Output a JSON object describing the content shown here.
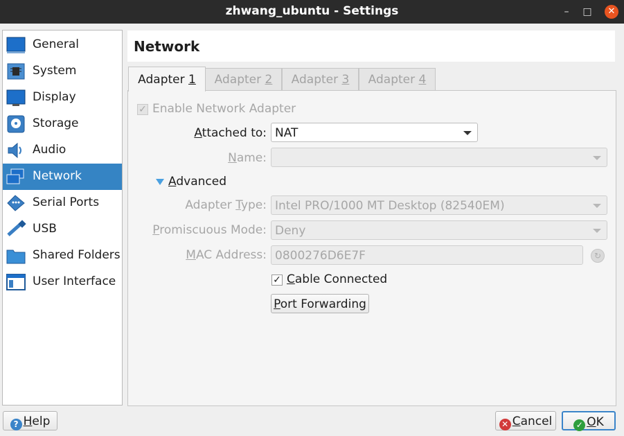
{
  "window": {
    "title": "zhwang_ubuntu - Settings"
  },
  "sidebar": {
    "items": [
      {
        "label": "General",
        "icon": "general-icon",
        "active": false
      },
      {
        "label": "System",
        "icon": "system-chip-icon",
        "active": false
      },
      {
        "label": "Display",
        "icon": "display-monitor-icon",
        "active": false
      },
      {
        "label": "Storage",
        "icon": "storage-disk-icon",
        "active": false
      },
      {
        "label": "Audio",
        "icon": "audio-speaker-icon",
        "active": false
      },
      {
        "label": "Network",
        "icon": "network-icon",
        "active": true
      },
      {
        "label": "Serial Ports",
        "icon": "serial-port-icon",
        "active": false
      },
      {
        "label": "USB",
        "icon": "usb-icon",
        "active": false
      },
      {
        "label": "Shared Folders",
        "icon": "folder-icon",
        "active": false
      },
      {
        "label": "User Interface",
        "icon": "user-interface-icon",
        "active": false
      }
    ]
  },
  "header": {
    "title": "Network"
  },
  "tabs": [
    {
      "label_prefix": "Adapter ",
      "mnemonic": "1",
      "active": true
    },
    {
      "label_prefix": "Adapter ",
      "mnemonic": "2",
      "active": false
    },
    {
      "label_prefix": "Adapter ",
      "mnemonic": "3",
      "active": false
    },
    {
      "label_prefix": "Adapter ",
      "mnemonic": "4",
      "active": false
    }
  ],
  "form": {
    "enable_adapter": {
      "label": "Enable Network Adapter",
      "checked": true,
      "enabled": false
    },
    "attached_to": {
      "label_mn": "A",
      "label_rest": "ttached to:",
      "value": "NAT"
    },
    "name": {
      "label_mn": "N",
      "label_rest": "ame:",
      "value": ""
    },
    "advanced": {
      "label_mn": "A",
      "label_rest": "dvanced",
      "expanded": true
    },
    "adapter_type": {
      "label_a": "Adapter ",
      "label_mn": "T",
      "label_b": "ype:",
      "value": "Intel PRO/1000 MT Desktop (82540EM)"
    },
    "promiscuous": {
      "label_mn": "P",
      "label_rest": "romiscuous Mode:",
      "value": "Deny"
    },
    "mac": {
      "label_mn": "M",
      "label_rest": "AC Address:",
      "value": "0800276D6E7F"
    },
    "cable_connected": {
      "label_mn": "C",
      "label_rest": "able Connected",
      "checked": true
    },
    "port_forwarding": {
      "label_mn": "P",
      "label_rest": "ort Forwarding"
    }
  },
  "footer": {
    "help": {
      "label_mn": "H",
      "label_rest": "elp"
    },
    "cancel": {
      "label_mn": "C",
      "label_rest": "ancel"
    },
    "ok": {
      "label_mn": "O",
      "label_rest": "K"
    }
  },
  "colors": {
    "accent": "#3584c4",
    "titlebar": "#2b2b2b",
    "close": "#e95420"
  }
}
